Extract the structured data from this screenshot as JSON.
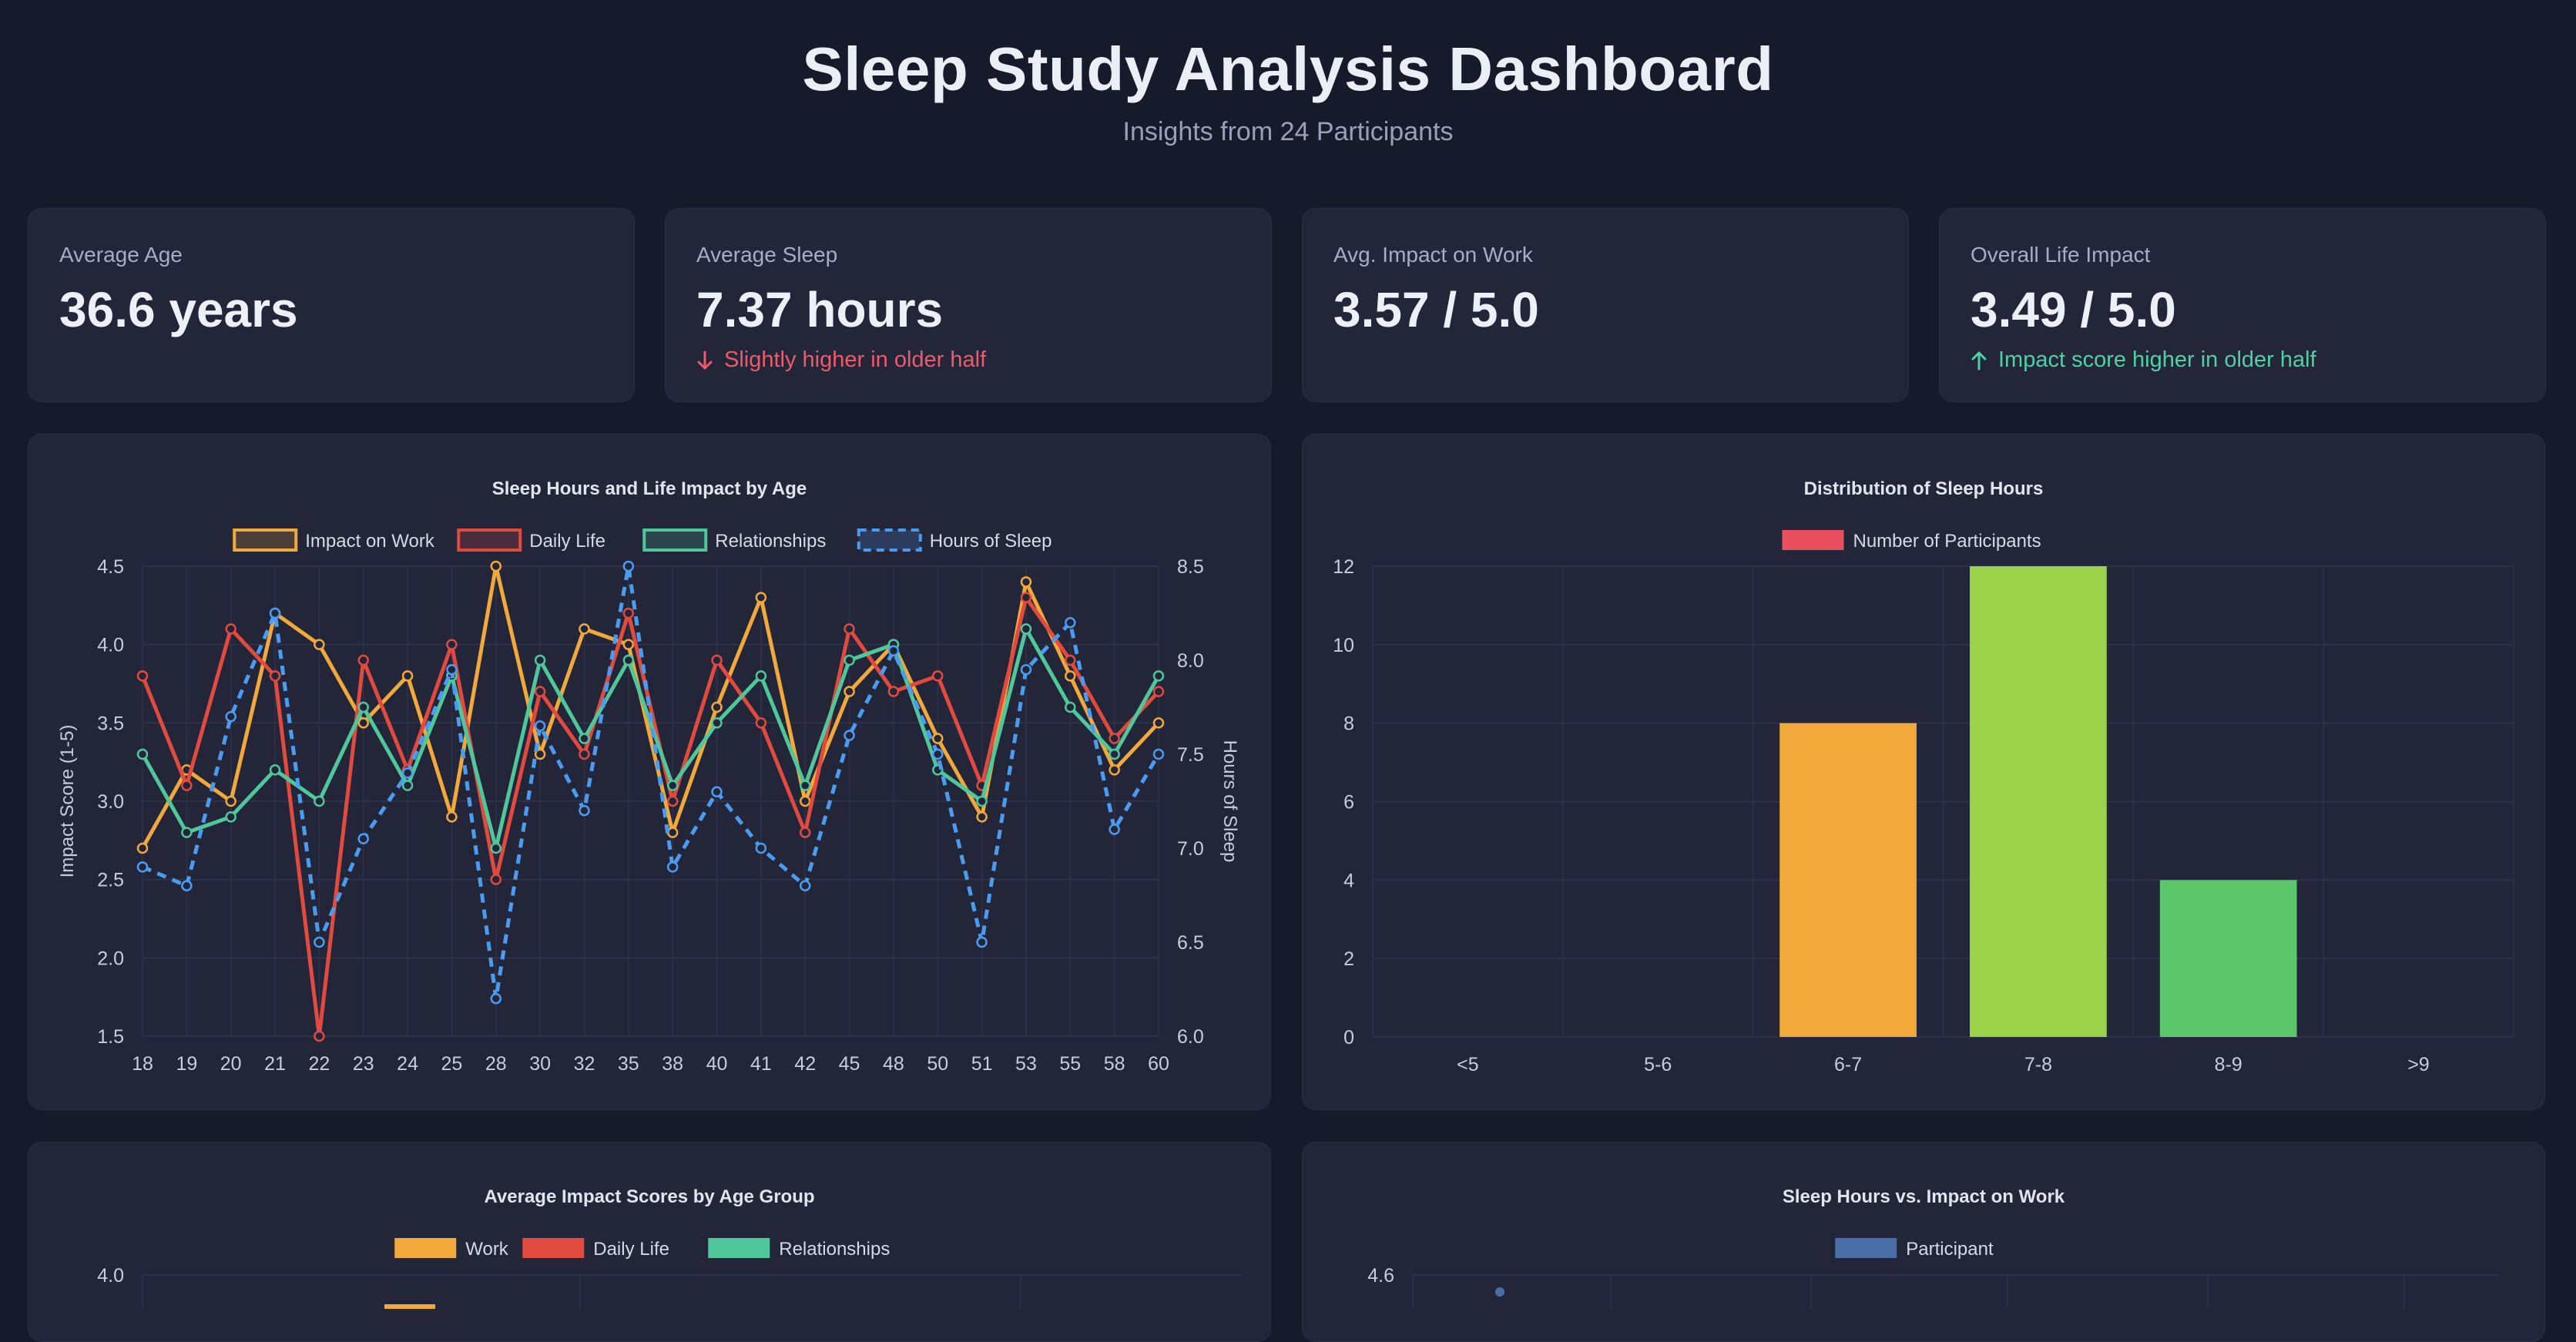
{
  "header": {
    "title": "Sleep Study Analysis Dashboard",
    "subtitle": "Insights from 24 Participants"
  },
  "stats": [
    {
      "label": "Average Age",
      "value": "36.6 years"
    },
    {
      "label": "Average Sleep",
      "value": "7.37 hours",
      "note": "Slightly higher in older half",
      "trend": "down"
    },
    {
      "label": "Avg. Impact on Work",
      "value": "3.57 / 5.0"
    },
    {
      "label": "Overall Life Impact",
      "value": "3.49 / 5.0",
      "note": "Impact score higher in older half",
      "trend": "up"
    }
  ],
  "colors": {
    "work": "#f2a93b",
    "daily": "#e04a3f",
    "relationships": "#4fc79a",
    "sleep": "#4b9cf0",
    "participant": "#4a6fa8",
    "bar_6_7": "#f2a93b",
    "bar_7_8": "#9bd24a",
    "bar_8_9": "#5cc66a",
    "legend_participants": "#e8505f"
  },
  "chart_data": [
    {
      "type": "line",
      "title": "Sleep Hours and Life Impact by Age",
      "x": [
        "18",
        "19",
        "20",
        "21",
        "22",
        "23",
        "24",
        "25",
        "28",
        "30",
        "32",
        "35",
        "38",
        "40",
        "41",
        "42",
        "45",
        "48",
        "50",
        "51",
        "53",
        "55",
        "58",
        "60"
      ],
      "ylabel": "Impact Score (1-5)",
      "ylabel_right": "Hours of Sleep",
      "ylim": [
        1.5,
        4.5
      ],
      "ylim_right": [
        6.0,
        8.5
      ],
      "yticks": [
        "1.5",
        "2.0",
        "2.5",
        "3.0",
        "3.5",
        "4.0",
        "4.5"
      ],
      "yticks_right": [
        "6.0",
        "6.5",
        "7.0",
        "7.5",
        "8.0",
        "8.5"
      ],
      "legend_position": "top",
      "grid": true,
      "series": [
        {
          "name": "Impact on Work",
          "axis": "left",
          "color": "#f2a93b",
          "values": [
            2.7,
            3.2,
            3.0,
            4.2,
            4.0,
            3.5,
            3.8,
            2.9,
            4.5,
            3.3,
            4.1,
            4.0,
            2.8,
            3.6,
            4.3,
            3.0,
            3.7,
            4.0,
            3.4,
            2.9,
            4.4,
            3.8,
            3.2,
            3.5
          ]
        },
        {
          "name": "Daily Life",
          "axis": "left",
          "color": "#e04a3f",
          "values": [
            3.8,
            3.1,
            4.1,
            3.8,
            1.5,
            3.9,
            3.2,
            4.0,
            2.5,
            3.7,
            3.3,
            4.2,
            3.0,
            3.9,
            3.5,
            2.8,
            4.1,
            3.7,
            3.8,
            3.1,
            4.3,
            3.9,
            3.4,
            3.7
          ]
        },
        {
          "name": "Relationships",
          "axis": "left",
          "color": "#4fc79a",
          "values": [
            3.3,
            2.8,
            2.9,
            3.2,
            3.0,
            3.6,
            3.1,
            3.8,
            2.7,
            3.9,
            3.4,
            3.9,
            3.1,
            3.5,
            3.8,
            3.1,
            3.9,
            4.0,
            3.2,
            3.0,
            4.1,
            3.6,
            3.3,
            3.8
          ]
        },
        {
          "name": "Hours of Sleep",
          "axis": "right",
          "color": "#4b9cf0",
          "dashed": true,
          "values": [
            6.9,
            6.8,
            7.7,
            8.25,
            6.5,
            7.05,
            7.4,
            7.95,
            6.2,
            7.65,
            7.2,
            8.5,
            6.9,
            7.3,
            7.0,
            6.8,
            7.6,
            8.05,
            7.5,
            6.5,
            7.95,
            8.2,
            7.1,
            7.5
          ]
        }
      ]
    },
    {
      "type": "bar",
      "title": "Distribution of Sleep Hours",
      "categories": [
        "<5",
        "5-6",
        "6-7",
        "7-8",
        "8-9",
        ">9"
      ],
      "series": [
        {
          "name": "Number of Participants",
          "values": [
            0,
            0,
            8,
            12,
            4,
            0
          ]
        }
      ],
      "ylim": [
        0,
        12
      ],
      "yticks": [
        "0",
        "2",
        "4",
        "6",
        "8",
        "10",
        "12"
      ],
      "legend_position": "top",
      "grid": true
    },
    {
      "type": "bar",
      "title": "Average Impact Scores by Age Group",
      "series": [
        {
          "name": "Work"
        },
        {
          "name": "Daily Life"
        },
        {
          "name": "Relationships"
        }
      ],
      "yticks": [
        "4.0"
      ],
      "legend_position": "top"
    },
    {
      "type": "scatter",
      "title": "Sleep Hours vs. Impact on Work",
      "series": [
        {
          "name": "Participant"
        }
      ],
      "yticks": [
        "4.6"
      ],
      "legend_position": "top"
    }
  ]
}
